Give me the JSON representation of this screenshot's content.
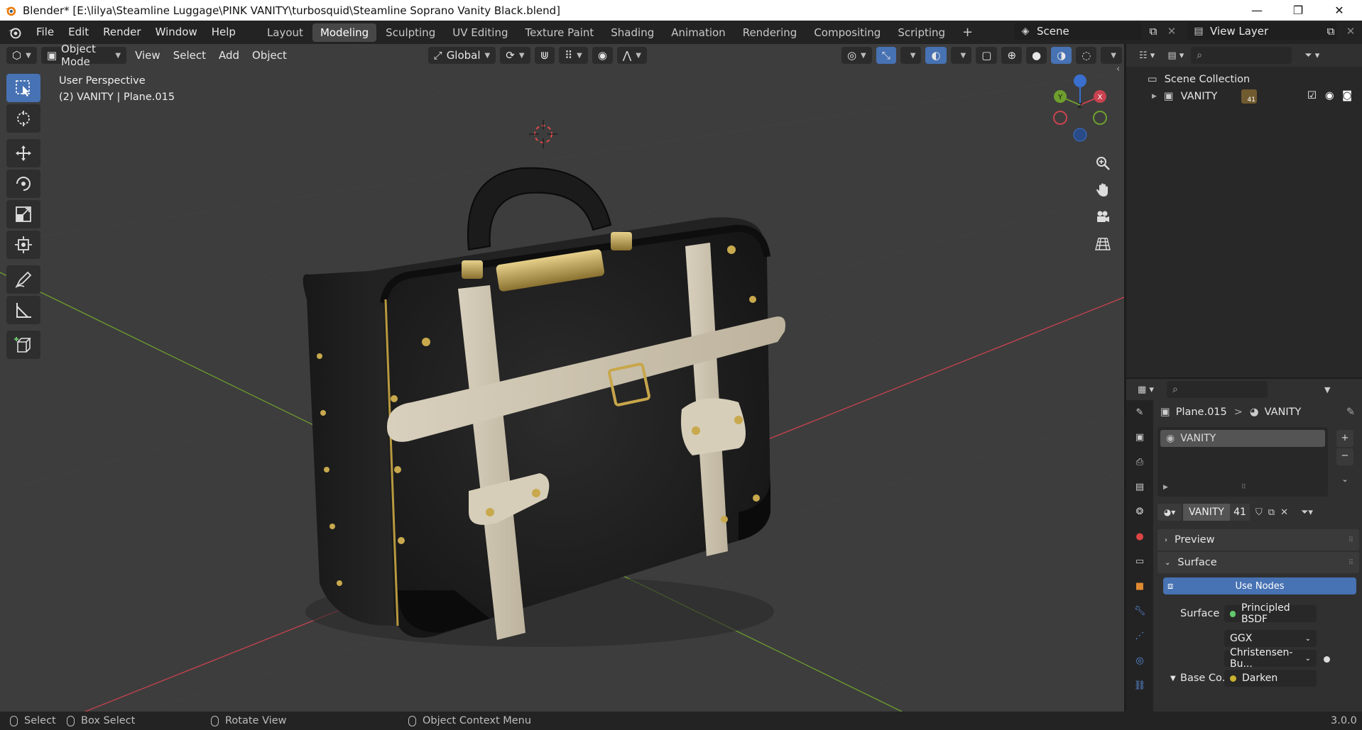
{
  "window": {
    "title": "Blender* [E:\\lilya\\Steamline Luggage\\PINK VANITY\\turbosquid\\Steamline Soprano  Vanity Black.blend]",
    "minimize": "—",
    "restore": "❐",
    "close": "✕"
  },
  "menubar": {
    "items": [
      "File",
      "Edit",
      "Render",
      "Window",
      "Help"
    ]
  },
  "workspaces": {
    "tabs": [
      "Layout",
      "Modeling",
      "Sculpting",
      "UV Editing",
      "Texture Paint",
      "Shading",
      "Animation",
      "Rendering",
      "Compositing",
      "Scripting"
    ],
    "active": "Modeling",
    "add_label": "+"
  },
  "scene": {
    "label": "Scene"
  },
  "view_layer": {
    "label": "View Layer"
  },
  "viewport_header": {
    "mode": "Object Mode",
    "menus": [
      "View",
      "Select",
      "Add",
      "Object"
    ],
    "transform_orientation": "Global"
  },
  "viewport": {
    "perspective": "User Perspective",
    "object_info": "(2)  VANITY | Plane.015",
    "gizmo_labels": {
      "x": "X",
      "y": "Y",
      "z": "Z"
    }
  },
  "tools": [
    "select-box",
    "cursor",
    "move",
    "rotate",
    "scale",
    "transform",
    "annotate",
    "measure",
    "add-cube"
  ],
  "outliner": {
    "root": "Scene Collection",
    "items": [
      {
        "label": "VANITY",
        "badge": "41"
      }
    ]
  },
  "properties": {
    "breadcrumb_object": "Plane.015",
    "breadcrumb_sep": ">",
    "breadcrumb_material": "VANITY",
    "material_slot": "VANITY",
    "material_name": "VANITY",
    "material_users": "41",
    "panels": {
      "preview": "Preview",
      "surface": "Surface"
    },
    "use_nodes": "Use Nodes",
    "surface_label": "Surface",
    "surface_value": "Principled BSDF",
    "distribution": "GGX",
    "subsurface_method": "Christensen-Bu...",
    "base_color_label": "Base Co...",
    "base_color_value": "Darken"
  },
  "statusbar": {
    "select": "Select",
    "box_select": "Box Select",
    "rotate_view": "Rotate View",
    "context_menu": "Object Context Menu",
    "version": "3.0.0"
  },
  "colors": {
    "accent": "#4772b3",
    "x_axis": "#c9424f",
    "y_axis": "#6e9e2e",
    "z_axis": "#3a6fcf",
    "viewport_bg": "#3d3d3d"
  }
}
